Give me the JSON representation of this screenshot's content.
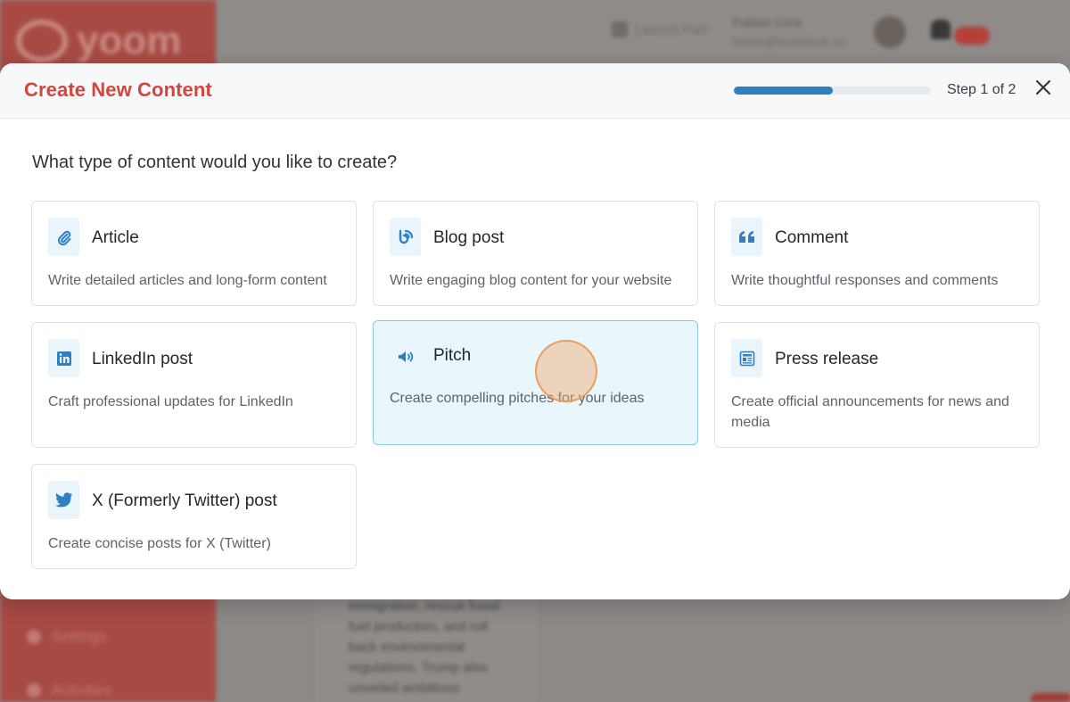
{
  "background": {
    "logo_text": "yoom",
    "launch_label": "Launch Pad",
    "user_name": "Fabian Cera",
    "user_email": "fabian@launchhub.co",
    "sidebar_items": [
      "Settings",
      "Activities"
    ],
    "article_excerpt": "immigration, rescue fossil fuel production, and roll back environmental regulations. Trump also unveiled ambitious"
  },
  "modal": {
    "title": "Create New Content",
    "step_label": "Step 1 of 2",
    "progress": 0.5,
    "question": "What type of content would you like to create?"
  },
  "cards": [
    {
      "title": "Article",
      "description": "Write detailed articles and long-form content",
      "icon": "paperclip-icon"
    },
    {
      "title": "Blog post",
      "description": "Write engaging blog content for your website",
      "icon": "blog-icon"
    },
    {
      "title": "Comment",
      "description": "Write thoughtful responses and comments",
      "icon": "quote-icon"
    },
    {
      "title": "LinkedIn post",
      "description": "Craft professional updates for LinkedIn",
      "icon": "linkedin-icon"
    },
    {
      "title": "Pitch",
      "description": "Create compelling pitches for your ideas",
      "icon": "megaphone-icon",
      "selected": true
    },
    {
      "title": "Press release",
      "description": "Create official announcements for news and media",
      "icon": "newspaper-icon"
    },
    {
      "title": "X (Formerly Twitter) post",
      "description": "Create concise posts for X (Twitter)",
      "icon": "twitter-icon"
    }
  ],
  "colors": {
    "brand_red": "#d2463c",
    "accent_blue": "#2f7fc1",
    "selected_bg": "#e9f6fc"
  }
}
